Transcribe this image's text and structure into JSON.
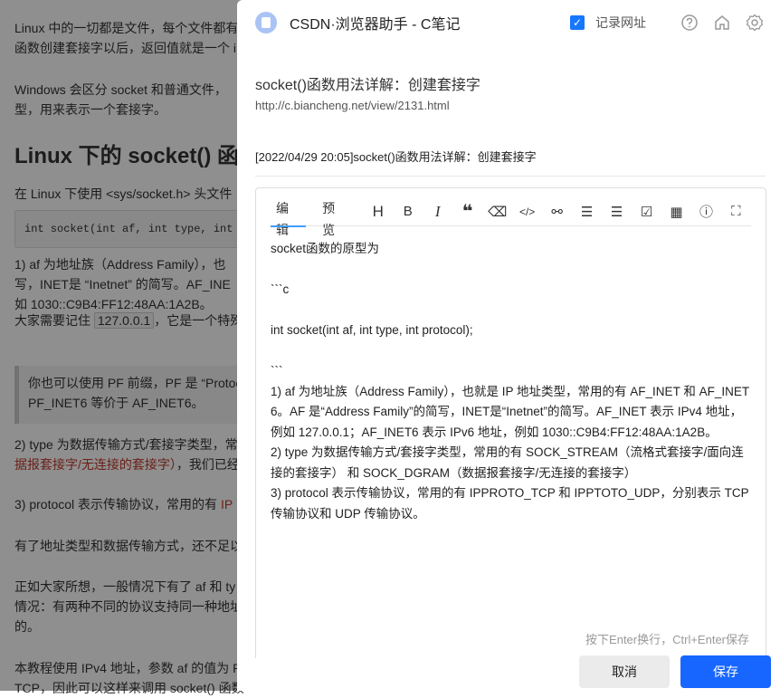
{
  "background_page": {
    "p1": [
      "Linux 中的一切都是文件，每个文件都有",
      "函数创建套接字以后，返回值就是一个 i"
    ],
    "p2": [
      "Windows 会区分 socket 和普通文件，",
      "型，用来表示一个套接字。"
    ],
    "heading": "Linux 下的 socket() 函",
    "p3": "在 Linux 下使用 <sys/socket.h> 头文件",
    "code": "int socket(int af, int type, int p",
    "p4": [
      "1) af 为地址族（Address Family），也",
      "写，INET是 “Inetnet” 的简写。AF_INE",
      "如 1030::C9B4:FF12:48AA:1A2B。"
    ],
    "p5_pre": "大家需要记住",
    "p5_code": "127.0.0.1",
    "p5_post": "，它是一个特殊",
    "quote": [
      "你也可以使用 PF 前缀，PF 是 “Protoc",
      "PF_INET6 等价于 AF_INET6。"
    ],
    "p6_1": "2) type 为数据传输方式/套接字类型，常",
    "p6_2_red": "据报套接字/无连接的套接字）",
    "p6_2_post": "，我们已经",
    "p7_pre": "3) protocol 表示传输协议，常用的有 ",
    "p7_red": "IP",
    "p8": "有了地址类型和数据传输方式，还不足以",
    "p9": [
      "正如大家所想，一般情况下有了 af 和 ty",
      "情况：有两种不同的协议支持同一种地址",
      "的。"
    ],
    "p10": [
      "本教程使用 IPv4 地址，参数 af 的值为 P",
      "TCP，因此可以这样来调用 socket() 函数"
    ]
  },
  "panel": {
    "title": "CSDN·浏览器助手 - C笔记",
    "record_url_label": "记录网址",
    "record_url_checked": true,
    "article_title": "socket()函数用法详解：创建套接字",
    "article_url": "http://c.biancheng.net/view/2131.html",
    "note_title": "[2022/04/29 20:05]socket()函数用法详解：创建套接字",
    "tabs": [
      "编辑",
      "预览"
    ],
    "editor_content": "socket函数的原型为\n\n```c\n\nint socket(int af, int type, int protocol);\n\n```\n1) af 为地址族（Address Family），也就是 IP 地址类型，常用的有 AF_INET 和 AF_INET6。AF 是“Address Family”的简写，INET是“Inetnet”的简写。AF_INET 表示 IPv4 地址，例如 127.0.0.1；AF_INET6 表示 IPv6 地址，例如 1030::C9B4:FF12:48AA:1A2B。\n2) type 为数据传输方式/套接字类型，常用的有 SOCK_STREAM（流格式套接字/面向连接的套接字） 和 SOCK_DGRAM（数据报套接字/无连接的套接字）\n3) protocol 表示传输协议，常用的有 IPPROTO_TCP 和 IPPTOTO_UDP，分别表示 TCP 传输协议和 UDP 传输协议。",
    "hint": "按下Enter换行，Ctrl+Enter保存",
    "cancel_label": "取消",
    "save_label": "保存",
    "accent_color": "#1766ff"
  }
}
